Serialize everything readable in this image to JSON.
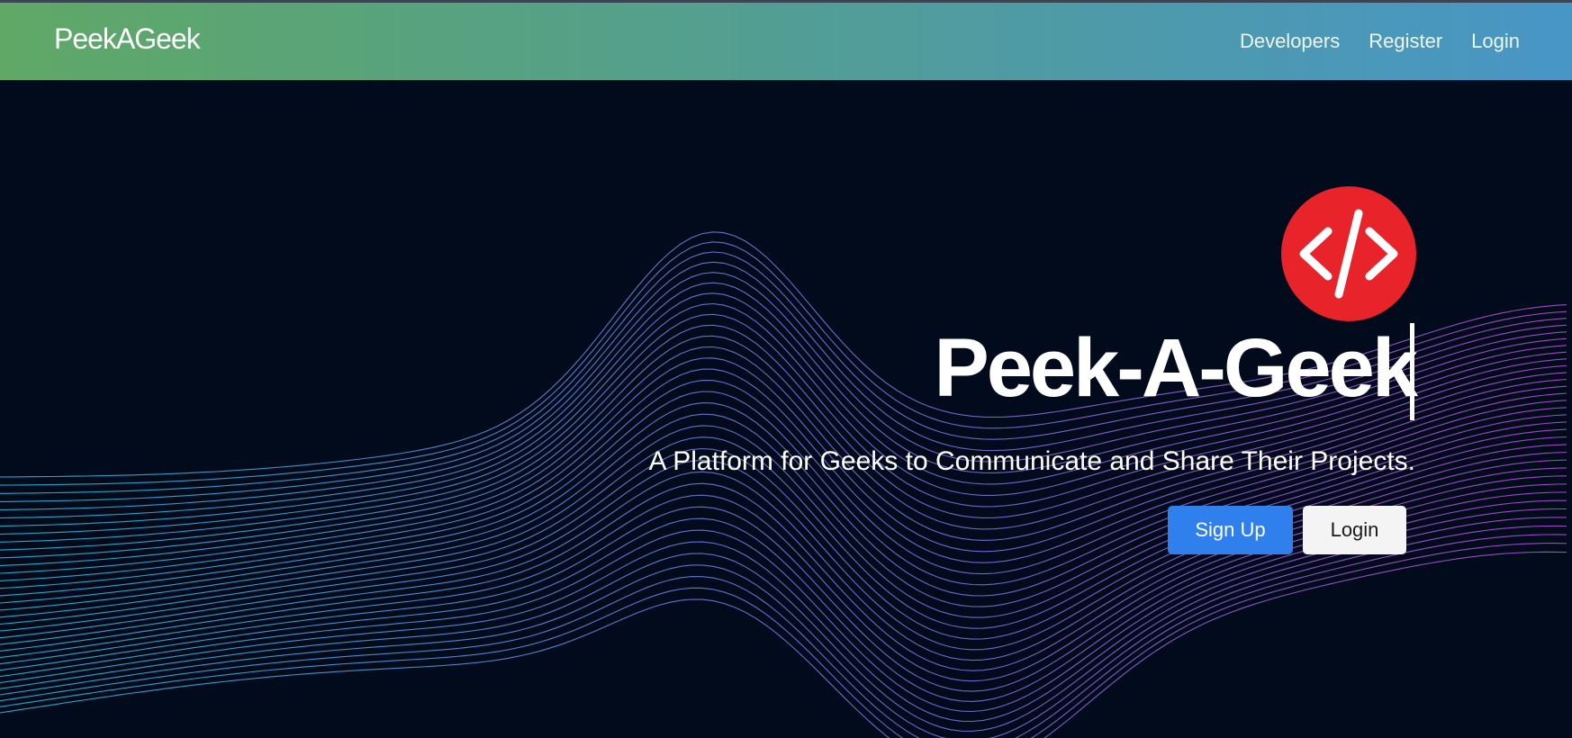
{
  "navbar": {
    "brand": "PeekAGeek",
    "links": [
      {
        "label": "Developers"
      },
      {
        "label": "Register"
      },
      {
        "label": "Login"
      }
    ]
  },
  "hero": {
    "logo_icon": "code-brackets-icon",
    "logo_color": "#e8232a",
    "title": "Peek-A-Geek",
    "subtitle": "A Platform for Geeks to Communicate and Share Their Projects.",
    "signup_label": "Sign Up",
    "login_label": "Login"
  },
  "colors": {
    "background": "#010b1c",
    "navbar_gradient_start": "#5fa866",
    "navbar_gradient_end": "#4896c6",
    "primary_button": "#2f80ed",
    "wave_cyan": "#2ec4e6",
    "wave_violet": "#7b7ee8",
    "wave_magenta": "#c04ee0"
  }
}
